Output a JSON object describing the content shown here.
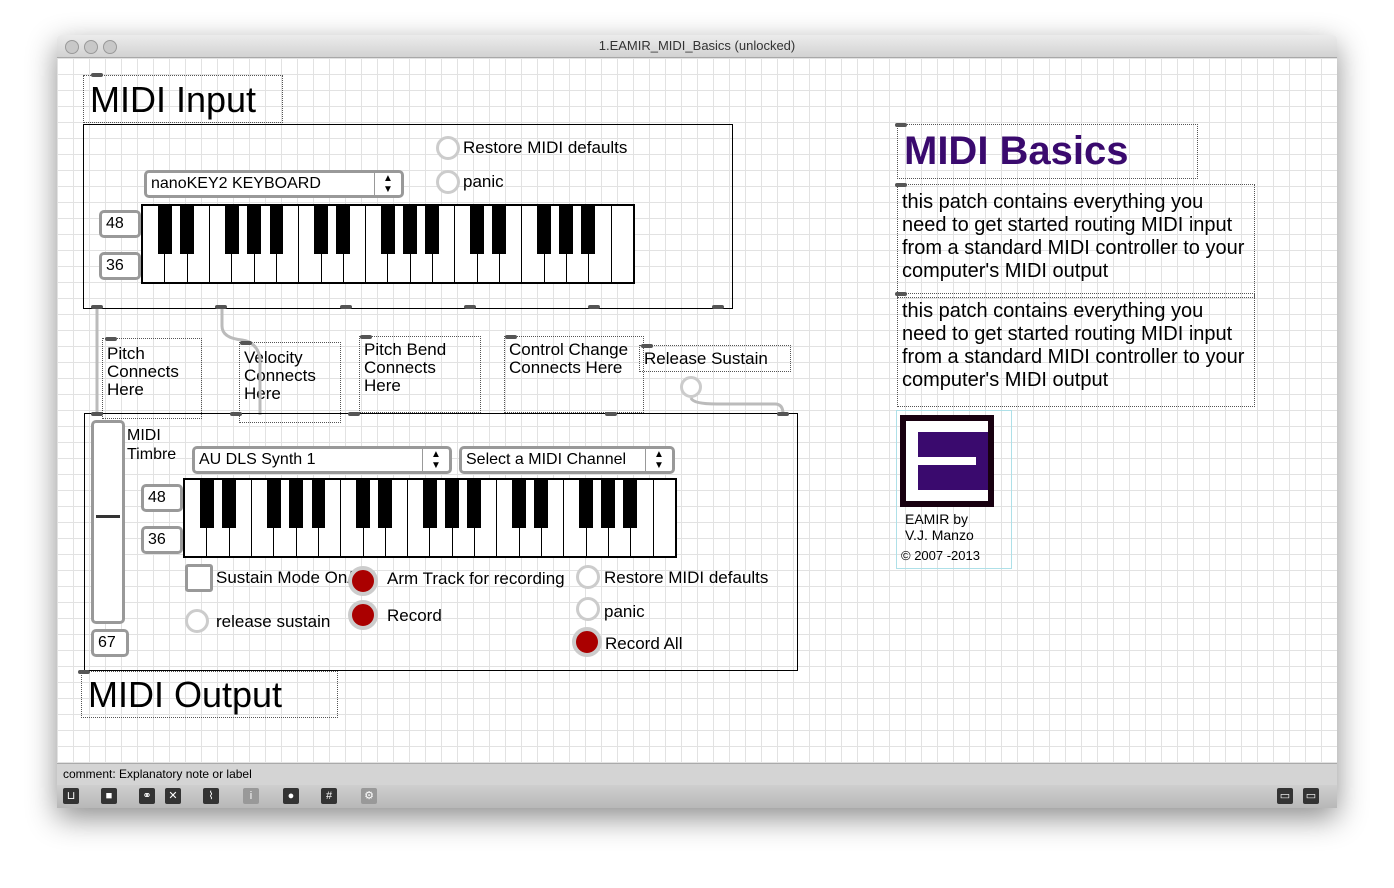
{
  "window": {
    "title": "1.EAMIR_MIDI_Basics (unlocked)"
  },
  "midi_input": {
    "title": "MIDI Input",
    "device": "nanoKEY2 KEYBOARD",
    "restore_label": "Restore MIDI defaults",
    "panic_label": "panic",
    "num_top": "48",
    "num_bottom": "36"
  },
  "comments": {
    "pitch": "Pitch Connects Here",
    "velocity": "Velocity Connects Here",
    "pitch_bend": "Pitch Bend Connects Here",
    "control_change": "Control Change Connects Here",
    "release_sustain": "Release Sustain"
  },
  "midi_output": {
    "title": "MIDI Output",
    "timbre_label": "MIDI Timbre",
    "synth": "AU DLS Synth 1",
    "channel": "Select a MIDI Channel",
    "num_top": "48",
    "num_bottom": "36",
    "slider_value": "67",
    "sustain_label": "Sustain Mode On/Off",
    "release_label": "release sustain",
    "arm_label": "Arm Track for recording",
    "record_label": "Record",
    "restore_label": "Restore MIDI defaults",
    "panic_label": "panic",
    "record_all_label": "Record All"
  },
  "info": {
    "title": "MIDI Basics",
    "desc1": "this patch contains everything you need to get started routing MIDI input from a standard MIDI controller to your computer's MIDI output",
    "desc2": "this patch contains everything you need to get started routing MIDI input from a standard MIDI controller to your computer's MIDI output",
    "logo_line1": "EAMIR  by",
    "logo_line2": "V.J. Manzo",
    "copyright": "© 2007 -2013"
  },
  "colors": {
    "title_purple": "#3a0a6e",
    "led_red": "#a00000"
  },
  "status": {
    "text": "comment: Explanatory note or label"
  },
  "toolbar": {
    "icons": [
      "lock-icon",
      "new-object-icon",
      "binoculars-icon",
      "clear-icon",
      "presentation-icon",
      "info-icon",
      "patch-cord-icon",
      "grid-icon",
      "debug-icon"
    ],
    "right_icons": [
      "patching-view-icon",
      "presentation-view-icon"
    ]
  }
}
